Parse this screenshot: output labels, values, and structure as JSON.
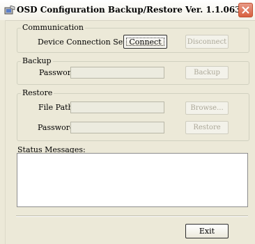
{
  "window": {
    "title": "OSD Configuration Backup/Restore   Ver. 1.1.063",
    "close_icon": "close-icon",
    "app_icon": "shield-icon"
  },
  "communication": {
    "legend": "Communication",
    "setting_label": "Device Connection Setting:",
    "connect_label": "Connect",
    "disconnect_label": "Disconnect"
  },
  "backup": {
    "legend": "Backup",
    "password_label": "Password:",
    "password_value": "",
    "backup_label": "Backup"
  },
  "restore": {
    "legend": "Restore",
    "file_path_label": "File Path:",
    "file_path_value": "",
    "browse_label": "Browse...",
    "password_label": "Password:",
    "password_value": "",
    "restore_label": "Restore"
  },
  "status": {
    "label": "Status Messages:",
    "messages": ""
  },
  "footer": {
    "exit_label": "Exit"
  }
}
